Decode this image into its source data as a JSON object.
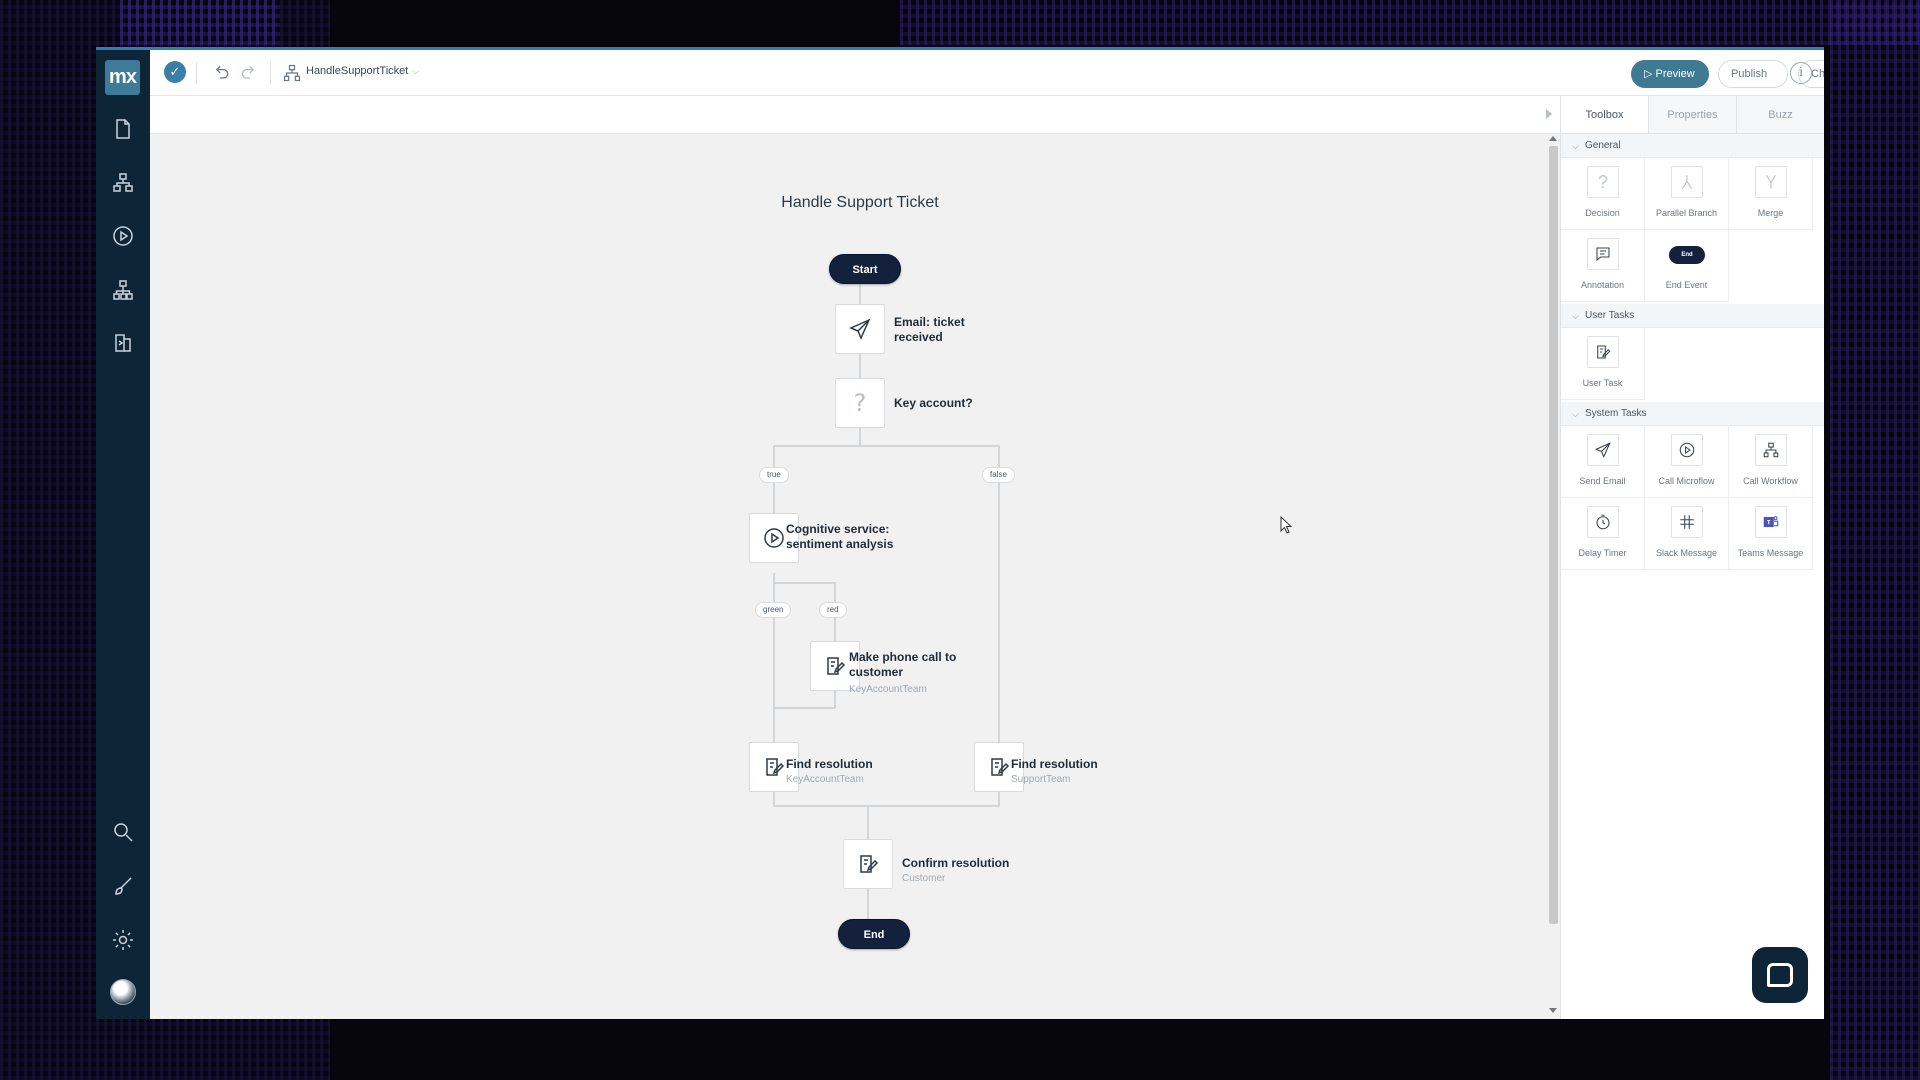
{
  "app": {
    "logo": "mx",
    "document_name": "HandleSupportTicket",
    "buttons": {
      "preview": "Preview",
      "publish": "Publish",
      "checks": "Checks"
    }
  },
  "sidebar": {
    "items": [
      {
        "icon": "page-icon"
      },
      {
        "icon": "domain-model-icon"
      },
      {
        "icon": "play-icon"
      },
      {
        "icon": "workflow-icon"
      },
      {
        "icon": "export-icon"
      }
    ],
    "bottom": [
      {
        "icon": "search-icon"
      },
      {
        "icon": "brush-icon"
      },
      {
        "icon": "gear-icon"
      },
      {
        "icon": "avatar"
      }
    ]
  },
  "flow": {
    "title": "Handle Support Ticket",
    "start": "Start",
    "end": "End",
    "nodes": {
      "email": {
        "label": "Email: ticket received"
      },
      "decision": {
        "label": "Key account?"
      },
      "cognitive": {
        "label": "Cognitive service: sentiment analysis"
      },
      "phone": {
        "label": "Make phone call to customer",
        "sub": "KeyAccountTeam"
      },
      "find_key": {
        "label": "Find resolution",
        "sub": "KeyAccountTeam"
      },
      "find_support": {
        "label": "Find resolution",
        "sub": "SupportTeam"
      },
      "confirm": {
        "label": "Confirm resolution",
        "sub": "Customer"
      }
    },
    "edge_labels": {
      "true": "true",
      "false": "false",
      "green": "green",
      "red": "red"
    }
  },
  "panel": {
    "tabs": [
      "Toolbox",
      "Properties",
      "Buzz"
    ],
    "active_tab": "Toolbox",
    "sections": [
      {
        "title": "General",
        "tools": [
          "Decision",
          "Parallel Branch",
          "Merge",
          "Annotation",
          "End Event"
        ]
      },
      {
        "title": "User Tasks",
        "tools": [
          "User Task"
        ]
      },
      {
        "title": "System Tasks",
        "tools": [
          "Send Email",
          "Call Microflow",
          "Call Workflow",
          "Delay Timer",
          "Slack Message",
          "Teams Message"
        ]
      }
    ],
    "end_event_badge": "End"
  },
  "colors": {
    "sidebar": "#0e2437",
    "accent": "#3f7a93",
    "pill": "#14213d",
    "canvas": "#f1f1f1"
  }
}
